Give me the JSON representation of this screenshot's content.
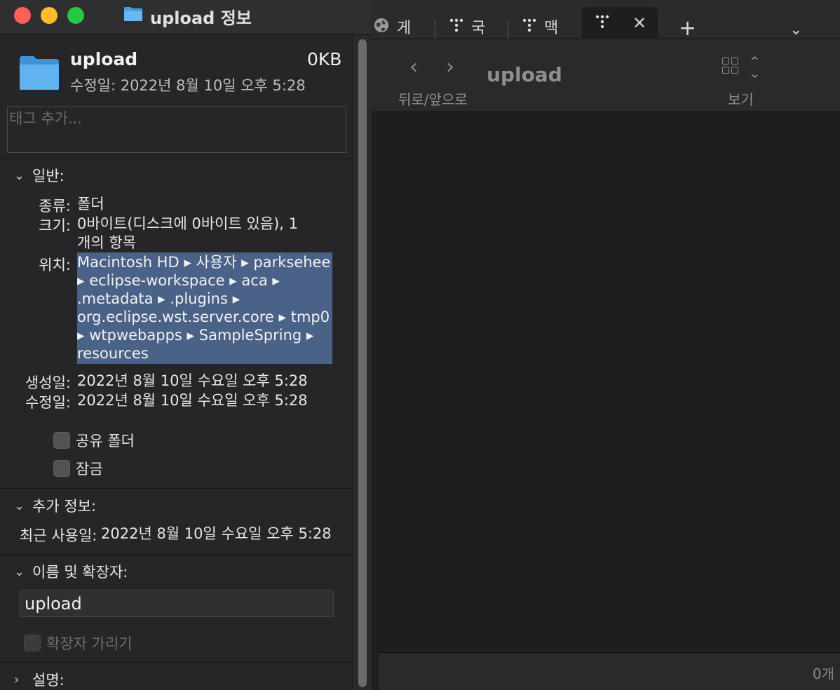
{
  "finder": {
    "tabs": [
      {
        "icon": "globe-icon",
        "label": "게",
        "active": false
      },
      {
        "icon": "dots-icon",
        "label": "국",
        "active": false
      },
      {
        "icon": "dots-icon",
        "label": "맥",
        "active": false
      },
      {
        "icon": "dots-icon",
        "label": "",
        "active": true
      }
    ],
    "close_glyph": "✕",
    "new_tab_glyph": "+",
    "overflow_glyph": "⌄",
    "back_glyph": "‹",
    "forward_glyph": "›",
    "nav_label": "뒤로/앞으로",
    "folder_title": "upload",
    "view_label": "보기",
    "item_count": "0개"
  },
  "info": {
    "window_title": "upload 정보",
    "name": "upload",
    "size": "0KB",
    "modified_line": "수정일: 2022년 8월 10일 오후 5:28",
    "tags_placeholder": "태그 추가...",
    "general": {
      "header": "일반:",
      "kind_label": "종류:",
      "kind_value": "폴더",
      "size_label": "크기:",
      "size_value_line1": "0바이트(디스크에 0바이트 있음), 1",
      "size_value_line2": "개의 항목",
      "where_label": "위치:",
      "where_lines": [
        "Macintosh HD ▸ 사용자 ▸ parksehee",
        "▸ eclipse-workspace ▸ aca ▸",
        ".metadata ▸ .plugins ▸",
        "org.eclipse.wst.server.core ▸ tmp0",
        "▸ wtpwebapps ▸ SampleSpring ▸",
        "resources"
      ],
      "created_label": "생성일:",
      "created_value": "2022년 8월 10일 수요일 오후 5:28",
      "modified_label": "수정일:",
      "modified_value": "2022년 8월 10일 수요일 오후 5:28",
      "shared_folder_label": "공유 폴더",
      "locked_label": "잠금"
    },
    "more_info": {
      "header": "추가 정보:",
      "last_opened_label": "최근 사용일:",
      "last_opened_value": "2022년 8월 10일 수요일 오후 5:28"
    },
    "name_ext": {
      "header": "이름 및 확장자:",
      "name_value": "upload",
      "hide_extension_label": "확장자 가리기"
    },
    "comments": {
      "header": "설명:"
    }
  },
  "colors": {
    "close": "#fe5f57",
    "minimize": "#febc2e",
    "maximize": "#28c840",
    "selection": "#4a6288",
    "folder_blue": "#5fb1ec"
  }
}
